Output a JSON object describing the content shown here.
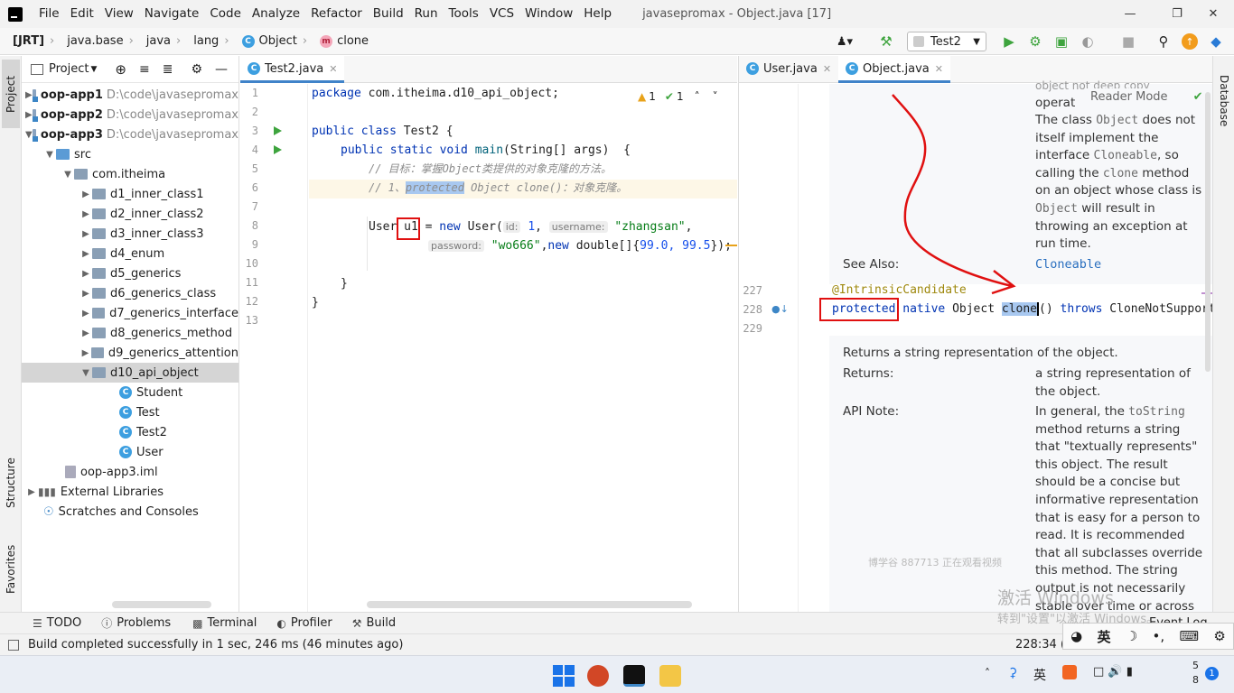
{
  "menubar": {
    "items": [
      "File",
      "Edit",
      "View",
      "Navigate",
      "Code",
      "Analyze",
      "Refactor",
      "Build",
      "Run",
      "Tools",
      "VCS",
      "Window",
      "Help"
    ],
    "title": "javasepromax - Object.java [17]"
  },
  "navbar": {
    "crumbs": [
      "[JRT]",
      "java.base",
      "java",
      "lang",
      "Object",
      "clone"
    ],
    "run_config": "Test2"
  },
  "sidebar_left": {
    "project_tab": "Project",
    "structure_tab": "Structure",
    "favorites_tab": "Favorites"
  },
  "sidebar_right": {
    "database_tab": "Database"
  },
  "project": {
    "header": "Project",
    "tree": [
      {
        "label": "oop-app1",
        "path": "D:\\code\\javasepromax",
        "bold": true
      },
      {
        "label": "oop-app2",
        "path": "D:\\code\\javasepromax",
        "bold": true
      },
      {
        "label": "oop-app3",
        "path": "D:\\code\\javasepromax",
        "bold": true
      },
      {
        "label": "src"
      },
      {
        "label": "com.itheima"
      },
      {
        "label": "d1_inner_class1"
      },
      {
        "label": "d2_inner_class2"
      },
      {
        "label": "d3_inner_class3"
      },
      {
        "label": "d4_enum"
      },
      {
        "label": "d5_generics"
      },
      {
        "label": "d6_generics_class"
      },
      {
        "label": "d7_generics_interface"
      },
      {
        "label": "d8_generics_method"
      },
      {
        "label": "d9_generics_attention"
      },
      {
        "label": "d10_api_object"
      },
      {
        "label": "Student"
      },
      {
        "label": "Test"
      },
      {
        "label": "Test2"
      },
      {
        "label": "User"
      },
      {
        "label": "oop-app3.iml"
      },
      {
        "label": "External Libraries"
      },
      {
        "label": "Scratches and Consoles"
      }
    ]
  },
  "editor_left": {
    "tab": "Test2.java",
    "inspections": {
      "warnings": "1",
      "ok": "1"
    },
    "line_numbers": [
      "1",
      "2",
      "3",
      "4",
      "5",
      "6",
      "7",
      "8",
      "9",
      "10",
      "11",
      "12",
      "13"
    ],
    "code": {
      "l1_kw": "package",
      "l1_rest": " com.itheima.d10_api_object;",
      "l3_kw": "public class",
      "l3_rest": " Test2 {",
      "l4_kw": "public static void",
      "l4_fn": "main",
      "l4_rest": "(String[] args)  {",
      "l5": "// 目标：掌握Object类提供的对象克隆的方法。",
      "l6_a": "// 1、",
      "l6_b": "protected",
      "l6_c": " Object clone()：对象克隆。",
      "l8_a": "User ",
      "l8_var": "u1",
      "l8_b": " = ",
      "l8_new": "new",
      "l8_c": " User(",
      "hint_id": "id:",
      "l8_num": "1",
      "l8_comma": ", ",
      "hint_username": "username:",
      "l8_str": "\"zhangsan\"",
      "l8_end": ",",
      "hint_password": "password:",
      "l9_str": "\"wo666\"",
      "l9_a": ",",
      "l9_new": "new",
      "l9_b": " double[]{",
      "l9_nums": "99.0, 99.5",
      "l9_c": "});",
      "l11": "}",
      "l12": "}"
    }
  },
  "editor_right": {
    "tabs": [
      "User.java",
      "Object.java"
    ],
    "reader_mode": "Reader Mode",
    "doc_top_clip": "object  not  deep copy",
    "doc_top_clip2": "operat",
    "doc1": [
      "The class ",
      "Object",
      " does not itself implement the interface ",
      "Cloneable",
      ", so calling the ",
      "clone",
      " method on an object whose class is ",
      "Object",
      " will result in throwing an exception at run time."
    ],
    "see_also_label": "See Also:",
    "see_also_link": "Cloneable",
    "line_numbers": [
      "227",
      "228",
      "229"
    ],
    "annotation": "@IntrinsicCandidate",
    "sig_protected": "protected",
    "sig_native": "native",
    "sig_object": " Object ",
    "sig_clone": "clone",
    "sig_rest": "() ",
    "sig_throws": "throws",
    "sig_exc": " CloneNotSupport",
    "doc2_summary": "Returns a string representation of the object.",
    "returns_label": "Returns:",
    "returns_text": "a string representation of the object.",
    "api_note_label": "API Note:",
    "api_note": [
      "In general, the ",
      "toString",
      " method returns a string that \"textually represents\" this object. The result should be a concise but informative representation that is easy for a person to read. It is recommended that all subclasses override this method. The string output is not necessarily stable over time or across"
    ],
    "viewer_notice": "博学谷 887713 正在观看视频"
  },
  "bottom_tools": [
    "TODO",
    "Problems",
    "Terminal",
    "Profiler",
    "Build"
  ],
  "status": {
    "message": "Build completed successfully in 1 sec, 246 ms (46 minutes ago)",
    "position": "228:34 (5 chars)",
    "event_log": "Event Log"
  },
  "activation": {
    "line1": "激活 Windows",
    "line2": "转到\"设置\"以激活 Windows。"
  },
  "ime": {
    "lang": "英"
  },
  "taskbar": {
    "ime": "英",
    "clock_top": "5",
    "clock_bottom": "8",
    "badge": "1"
  },
  "colors": {
    "accent": "#4083c9",
    "annotation_red": "#e01010",
    "run_green": "#3ea43e"
  }
}
